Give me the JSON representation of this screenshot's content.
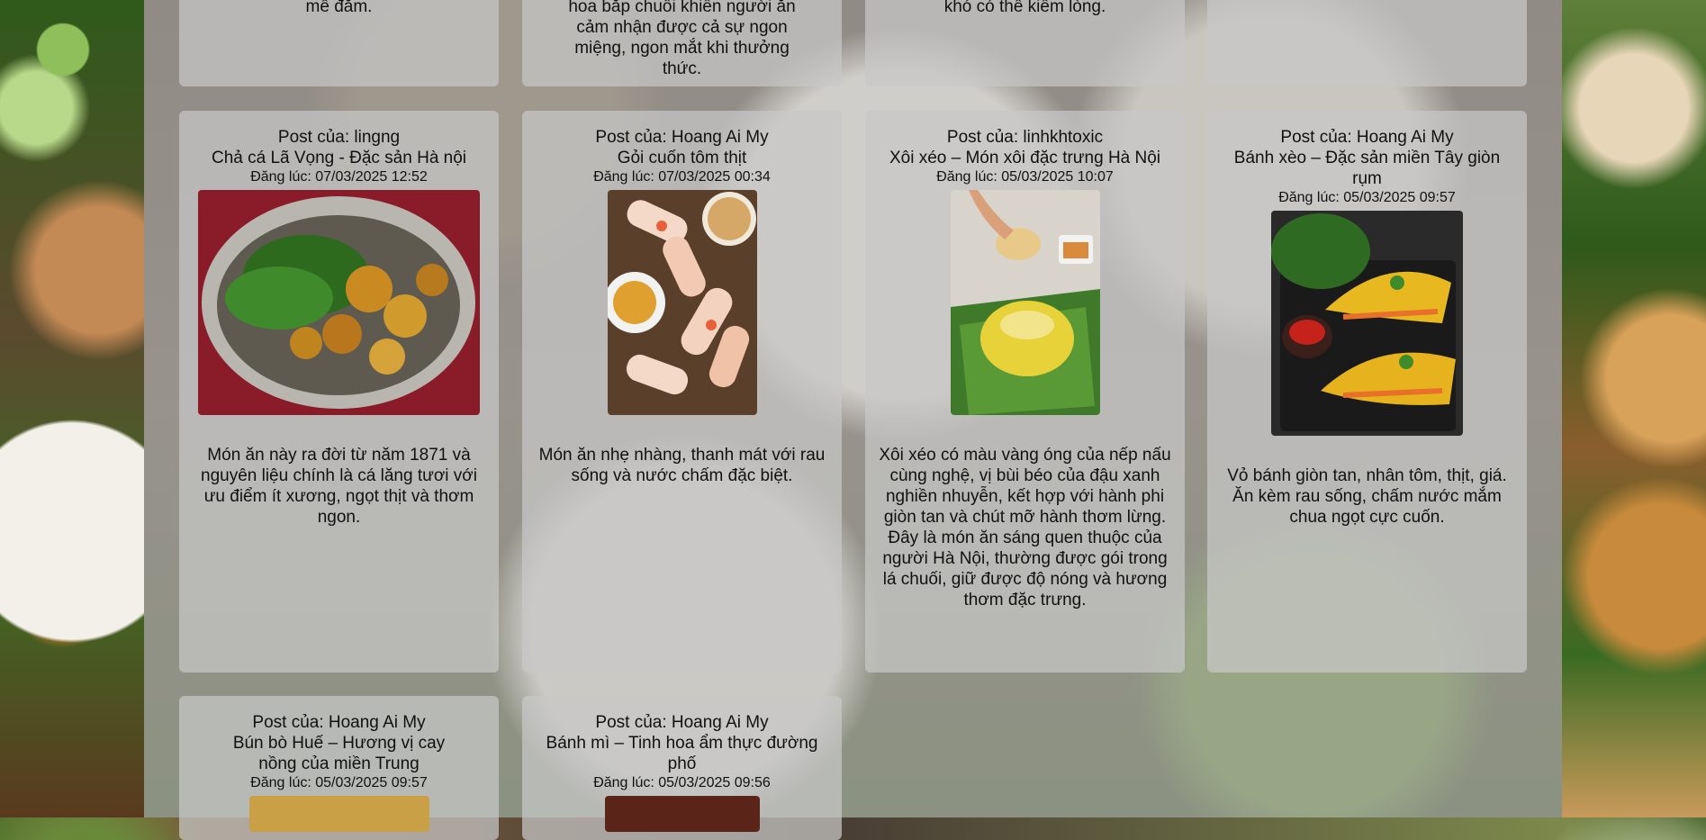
{
  "top_row": [
    {
      "desc_tail": "mê đắm."
    },
    {
      "desc_tail": "hoa bắp chuối khiến người ăn cảm nhận được cả sự ngon miệng, ngon mắt khi thưởng thức."
    },
    {
      "desc_tail": "khó có thể kiềm lòng."
    },
    {
      "desc_tail": ""
    }
  ],
  "posts": [
    {
      "author": "Post của: lingng",
      "title": "Chả cá Lã Vọng - Đặc sản Hà nội",
      "date": "Đăng lúc: 07/03/2025 12:52",
      "image": "cha-ca-pan-image",
      "desc": "Món ăn này ra đời từ năm 1871 và nguyên liệu chính là cá lăng tươi với ưu điểm ít xương, ngọt thịt và thơm ngon."
    },
    {
      "author": "Post của: Hoang Ai My",
      "title": "Gỏi cuốn tôm thịt",
      "date": "Đăng lúc: 07/03/2025 00:34",
      "image": "spring-rolls-image",
      "desc": "Món ăn nhẹ nhàng, thanh mát với rau sống và nước chấm đặc biệt."
    },
    {
      "author": "Post của: linhkhtoxic",
      "title": "Xôi xéo – Món xôi đặc trưng Hà Nội",
      "date": "Đăng lúc: 05/03/2025 10:07",
      "image": "xoi-xeo-image",
      "desc": "Xôi xéo có màu vàng óng của nếp nấu cùng nghệ, vị bùi béo của đậu xanh nghiền nhuyễn, kết hợp với hành phi giòn tan và chút mỡ hành thơm lừng. Đây là món ăn sáng quen thuộc của người Hà Nội, thường được gói trong lá chuối, giữ được độ nóng và hương thơm đặc trưng."
    },
    {
      "author": "Post của: Hoang Ai My",
      "title": "Bánh xèo – Đặc sản miền Tây giòn rụm",
      "date": "Đăng lúc: 05/03/2025 09:57",
      "image": "banh-xeo-image",
      "desc": "Vỏ bánh giòn tan, nhân tôm, thịt, giá. Ăn kèm rau sống, chấm nước mắm chua ngọt cực cuốn."
    },
    {
      "author": "Post của: Hoang Ai My",
      "title": "Bún bò Huế – Hương vị cay nồng của miền Trung",
      "date": "Đăng lúc: 05/03/2025 09:57",
      "image": "bun-bo-hue-image",
      "desc": ""
    },
    {
      "author": "Post của: Hoang Ai My",
      "title": "Bánh mì – Tinh hoa ẩm thực đường phố",
      "date": "Đăng lúc: 05/03/2025 09:56",
      "image": "banh-mi-image",
      "desc": ""
    }
  ]
}
